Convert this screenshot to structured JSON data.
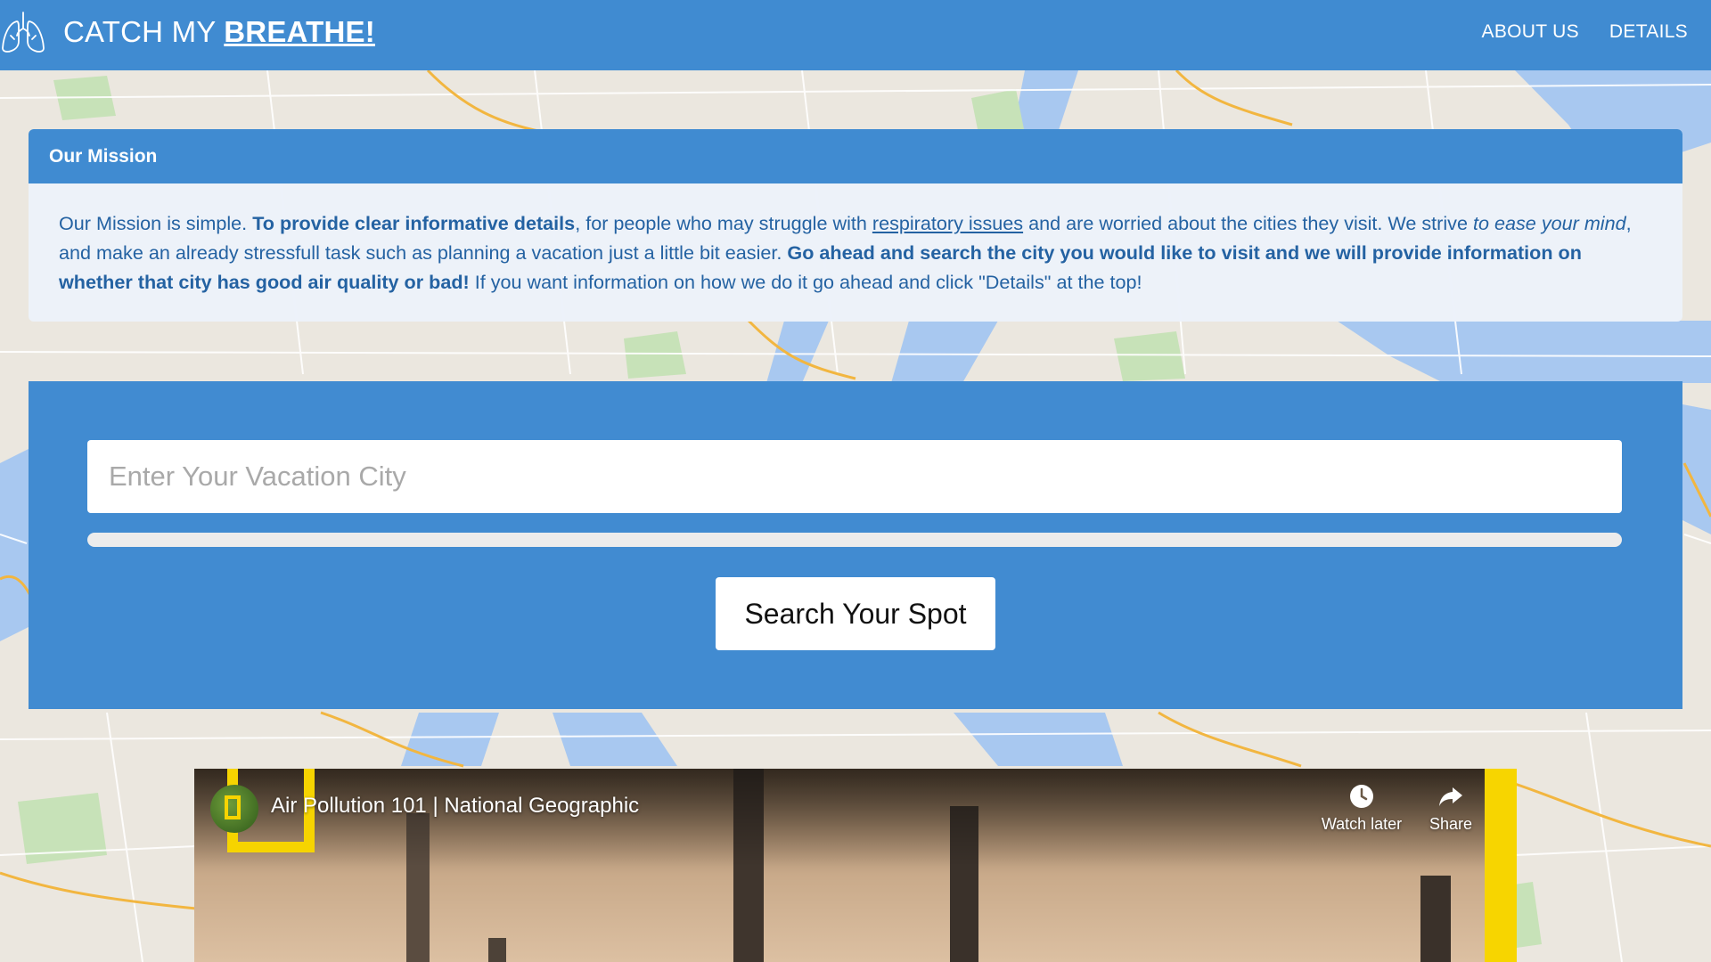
{
  "brand": {
    "title_prefix": "CATCH MY ",
    "title_accent": "BREATHE!",
    "logo_icon": "lungs-icon"
  },
  "nav": {
    "items": [
      {
        "label": "ABOUT US"
      },
      {
        "label": "DETAILS"
      }
    ]
  },
  "mission": {
    "header": "Our Mission",
    "body": {
      "p1": "Our Mission is simple. ",
      "b1": "To provide clear informative details",
      "p2": ", for people who may struggle with ",
      "link": "respiratory issues",
      "p3": " and are worried about the cities they visit. We strive ",
      "i1": "to ease your mind",
      "p4": ", and make an already stressfull task such as planning a vacation just a little bit easier. ",
      "b2": "Go ahead and search the city you would like to visit and we will provide information on whether that city has good air quality or bad!",
      "p5": " If you want information on how we do it go ahead and click \"Details\" at the top!"
    }
  },
  "search": {
    "placeholder": "Enter Your Vacation City",
    "value": "",
    "button_label": "Search Your Spot",
    "progress": 0
  },
  "video": {
    "title": "Air Pollution 101 | National Geographic",
    "watch_later_label": "Watch later",
    "share_label": "Share",
    "icons": [
      "clock-icon",
      "share-arrow-icon"
    ]
  },
  "colors": {
    "primary": "#408bd1",
    "mission_text": "#2462a2",
    "card_bg": "#ecf2fa",
    "natgeo_yellow": "#f6d400"
  }
}
